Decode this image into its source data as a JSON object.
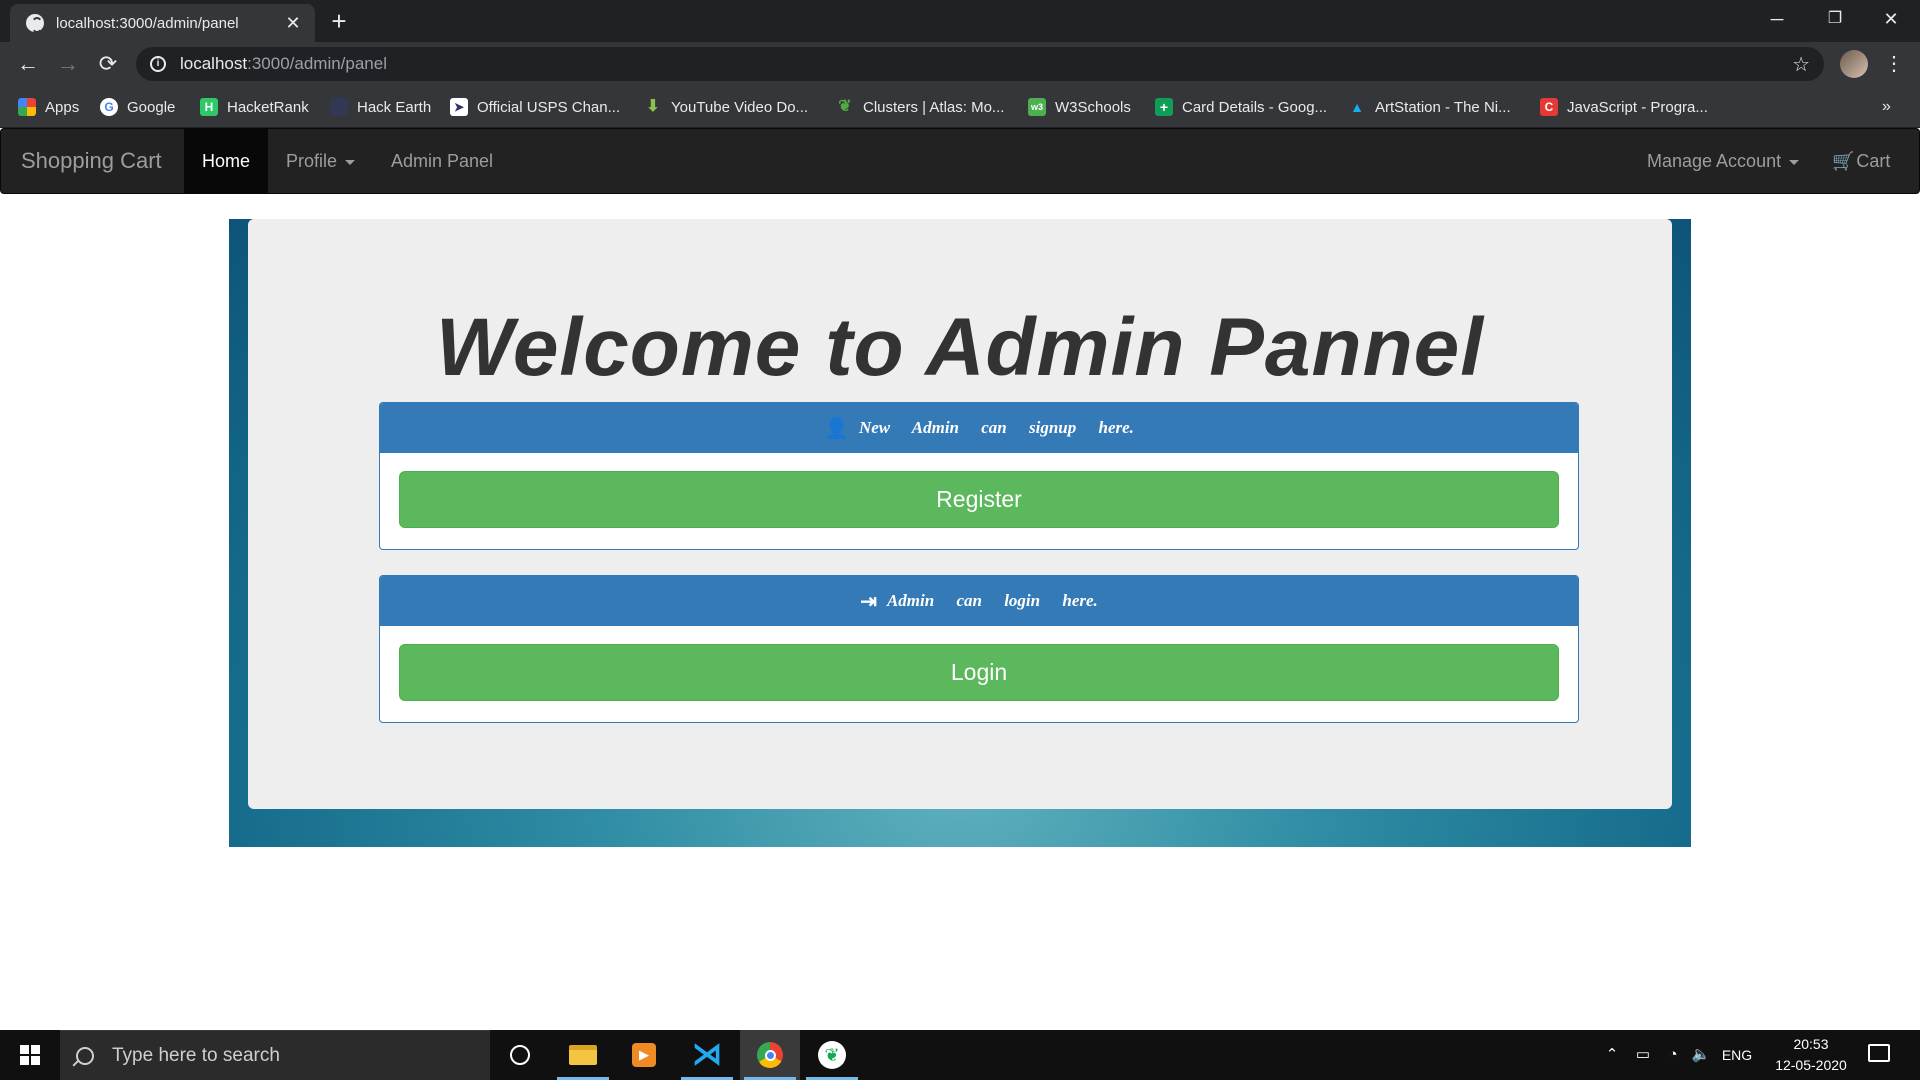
{
  "browser": {
    "tab_title": "localhost:3000/admin/panel",
    "tab_close": "✕",
    "new_tab": "+",
    "url_host": "localhost",
    "url_path": ":3000/admin/panel",
    "window_controls": {
      "minimize": "─",
      "restore": "❐",
      "close": "✕"
    },
    "bookmarks": [
      {
        "label": "Apps",
        "icon": "apps-grid-icon",
        "color": "#e94235"
      },
      {
        "label": "Google",
        "icon": "google-icon",
        "color": "#ffffff"
      },
      {
        "label": "HacketRank",
        "icon": "hackerrank-icon",
        "color": "#2ec866"
      },
      {
        "label": "Hack Earth",
        "icon": "hackerearth-icon",
        "color": "#323754"
      },
      {
        "label": "Official USPS Chan...",
        "icon": "usps-icon",
        "color": "#ffffff"
      },
      {
        "label": "YouTube Video Do...",
        "icon": "download-arrow-icon",
        "color": "#8bc34a"
      },
      {
        "label": "Clusters | Atlas: Mo...",
        "icon": "mongodb-leaf-icon",
        "color": "#4faa41"
      },
      {
        "label": "W3Schools",
        "icon": "w3schools-icon",
        "color": "#4caf50"
      },
      {
        "label": "Card Details - Goog...",
        "icon": "google-sheets-icon",
        "color": "#0f9d58"
      },
      {
        "label": "ArtStation - The Ni...",
        "icon": "artstation-icon",
        "color": "#13aff0"
      },
      {
        "label": "JavaScript - Progra...",
        "icon": "javascript-c-icon",
        "color": "#e53935"
      }
    ],
    "more": "»"
  },
  "navbar": {
    "brand": "Shopping Cart",
    "links": {
      "home": "Home",
      "profile": "Profile",
      "admin": "Admin Panel"
    },
    "right": {
      "manage": "Manage Account",
      "cart": "Cart"
    }
  },
  "main": {
    "heading": "Welcome to Admin Pannel",
    "signup_panel": {
      "heading": "New Admin can signup here.",
      "button": "Register"
    },
    "login_panel": {
      "heading": "Admin can login here.",
      "button": "Login"
    }
  },
  "taskbar": {
    "search_placeholder": "Type here to search",
    "language": "ENG",
    "time": "20:53",
    "date": "12-05-2020"
  },
  "colors": {
    "primary": "#337ab7",
    "success": "#5cb85c",
    "navbar_bg": "#222222"
  }
}
